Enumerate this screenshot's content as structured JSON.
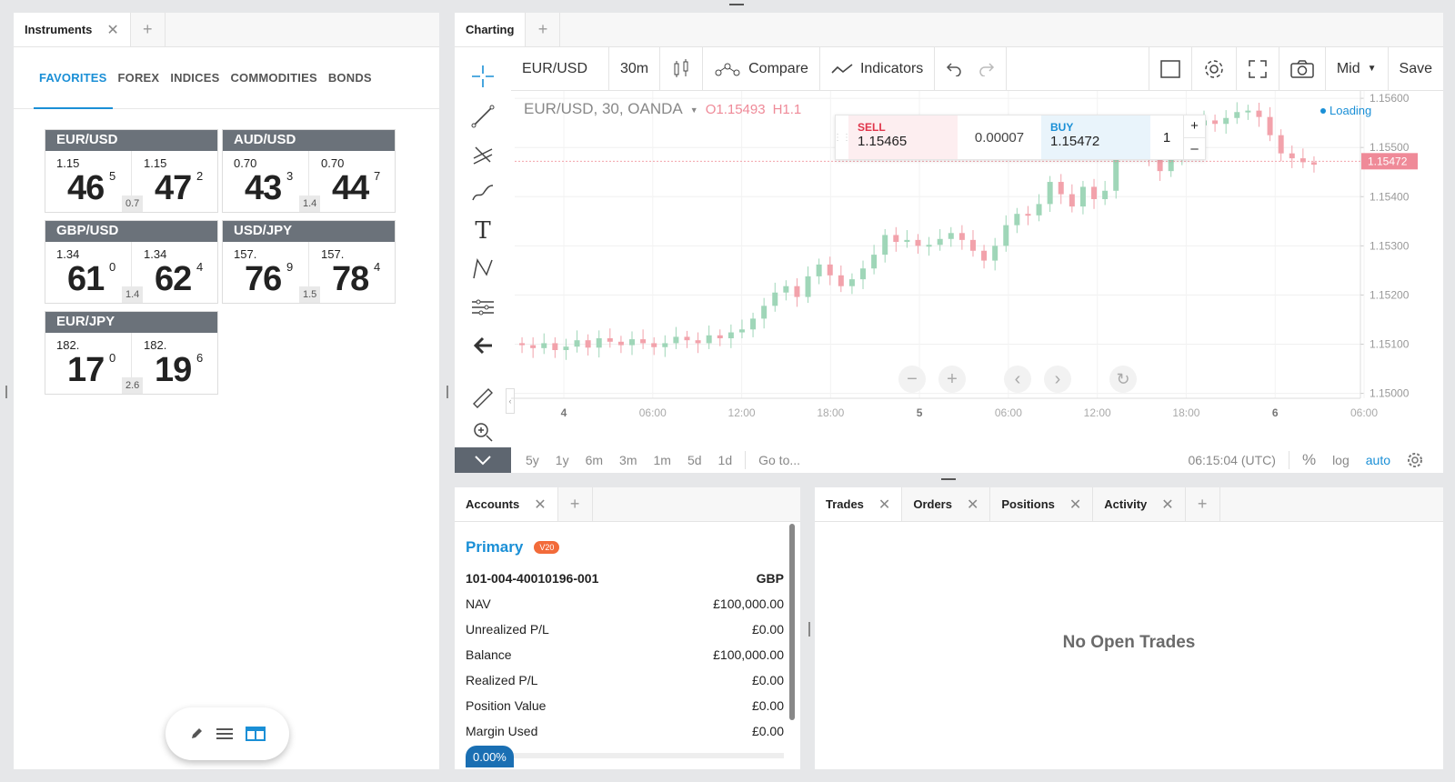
{
  "instruments": {
    "tab_label": "Instruments",
    "categories": [
      "FAVORITES",
      "FOREX",
      "INDICES",
      "COMMODITIES",
      "BONDS"
    ],
    "tiles": [
      {
        "pair": "EUR/USD",
        "sell_small": "1.15",
        "sell_big": "46",
        "sell_sup": "5",
        "buy_small": "1.15",
        "buy_big": "47",
        "buy_sup": "2",
        "spread": "0.7"
      },
      {
        "pair": "AUD/USD",
        "sell_small": "0.70",
        "sell_big": "43",
        "sell_sup": "3",
        "buy_small": "0.70",
        "buy_big": "44",
        "buy_sup": "7",
        "spread": "1.4"
      },
      {
        "pair": "GBP/USD",
        "sell_small": "1.34",
        "sell_big": "61",
        "sell_sup": "0",
        "buy_small": "1.34",
        "buy_big": "62",
        "buy_sup": "4",
        "spread": "1.4"
      },
      {
        "pair": "USD/JPY",
        "sell_small": "157.",
        "sell_big": "76",
        "sell_sup": "9",
        "buy_small": "157.",
        "buy_big": "78",
        "buy_sup": "4",
        "spread": "1.5"
      },
      {
        "pair": "EUR/JPY",
        "sell_small": "182.",
        "sell_big": "17",
        "sell_sup": "0",
        "buy_small": "182.",
        "buy_big": "19",
        "buy_sup": "6",
        "spread": "2.6"
      }
    ]
  },
  "charting": {
    "tab_label": "Charting",
    "symbol": "EUR/USD",
    "interval": "30m",
    "compare_label": "Compare",
    "indicators_label": "Indicators",
    "mid_label": "Mid",
    "save_label": "Save",
    "legend_symbol": "EUR/USD, 30, OANDA",
    "legend_o": "O1.15493",
    "legend_h": "H1.1",
    "sell_label": "SELL",
    "sell_price": "1.15465",
    "spread": "0.00007",
    "buy_label": "BUY",
    "buy_price": "1.15472",
    "quantity": "1",
    "loading_label": "Loading",
    "ranges": [
      "5y",
      "1y",
      "6m",
      "3m",
      "1m",
      "5d",
      "1d"
    ],
    "goto_label": "Go to...",
    "time_readout": "06:15:04 (UTC)",
    "percent_label": "%",
    "log_label": "log",
    "auto_label": "auto",
    "colors": {
      "up": "#9fd6b8",
      "down": "#f2a2ab",
      "accent": "#1a8fd6"
    }
  },
  "chart_data": {
    "type": "candlestick",
    "y_ticks": [
      "1.15600",
      "1.15500",
      "1.15400",
      "1.15300",
      "1.15200",
      "1.15100",
      "1.15000"
    ],
    "x_ticks": [
      "4",
      "06:00",
      "12:00",
      "18:00",
      "5",
      "06:00",
      "12:00",
      "18:00",
      "6",
      "06:00"
    ],
    "ylim": [
      1.15,
      1.156
    ],
    "last_price": "1.15472",
    "grid": true,
    "close": [
      1.15098,
      1.15092,
      1.15102,
      1.15088,
      1.15095,
      1.15108,
      1.15093,
      1.15112,
      1.15105,
      1.15098,
      1.1511,
      1.15102,
      1.15094,
      1.15102,
      1.15115,
      1.15108,
      1.15102,
      1.15118,
      1.15112,
      1.15124,
      1.1513,
      1.15152,
      1.15178,
      1.15205,
      1.15218,
      1.15196,
      1.15238,
      1.15262,
      1.1524,
      1.15218,
      1.15232,
      1.15254,
      1.15282,
      1.15322,
      1.15308,
      1.15312,
      1.153,
      1.15302,
      1.15314,
      1.15326,
      1.15312,
      1.1529,
      1.1527,
      1.153,
      1.15342,
      1.15365,
      1.15362,
      1.15385,
      1.1543,
      1.15405,
      1.1538,
      1.1542,
      1.15395,
      1.15412,
      1.155,
      1.15532,
      1.15505,
      1.15478,
      1.15452,
      1.1548,
      1.15512,
      1.15545,
      1.15555,
      1.15548,
      1.1556,
      1.15572,
      1.15575,
      1.15562,
      1.15525,
      1.15488,
      1.15478,
      1.1547,
      1.15465
    ]
  },
  "accounts": {
    "tab_label": "Accounts",
    "name": "Primary",
    "badge": "V20",
    "account_id": "101-004-40010196-001",
    "currency": "GBP",
    "rows": [
      {
        "label": "NAV",
        "value": "£100,000.00"
      },
      {
        "label": "Unrealized P/L",
        "value": "£0.00"
      },
      {
        "label": "Balance",
        "value": "£100,000.00"
      },
      {
        "label": "Realized P/L",
        "value": "£0.00"
      },
      {
        "label": "Position Value",
        "value": "£0.00"
      },
      {
        "label": "Margin Used",
        "value": "£0.00"
      }
    ],
    "margin_pct_label": "0.00%",
    "margin_pct": 0
  },
  "trades": {
    "tabs": [
      "Trades",
      "Orders",
      "Positions",
      "Activity"
    ],
    "empty_label": "No Open Trades"
  }
}
